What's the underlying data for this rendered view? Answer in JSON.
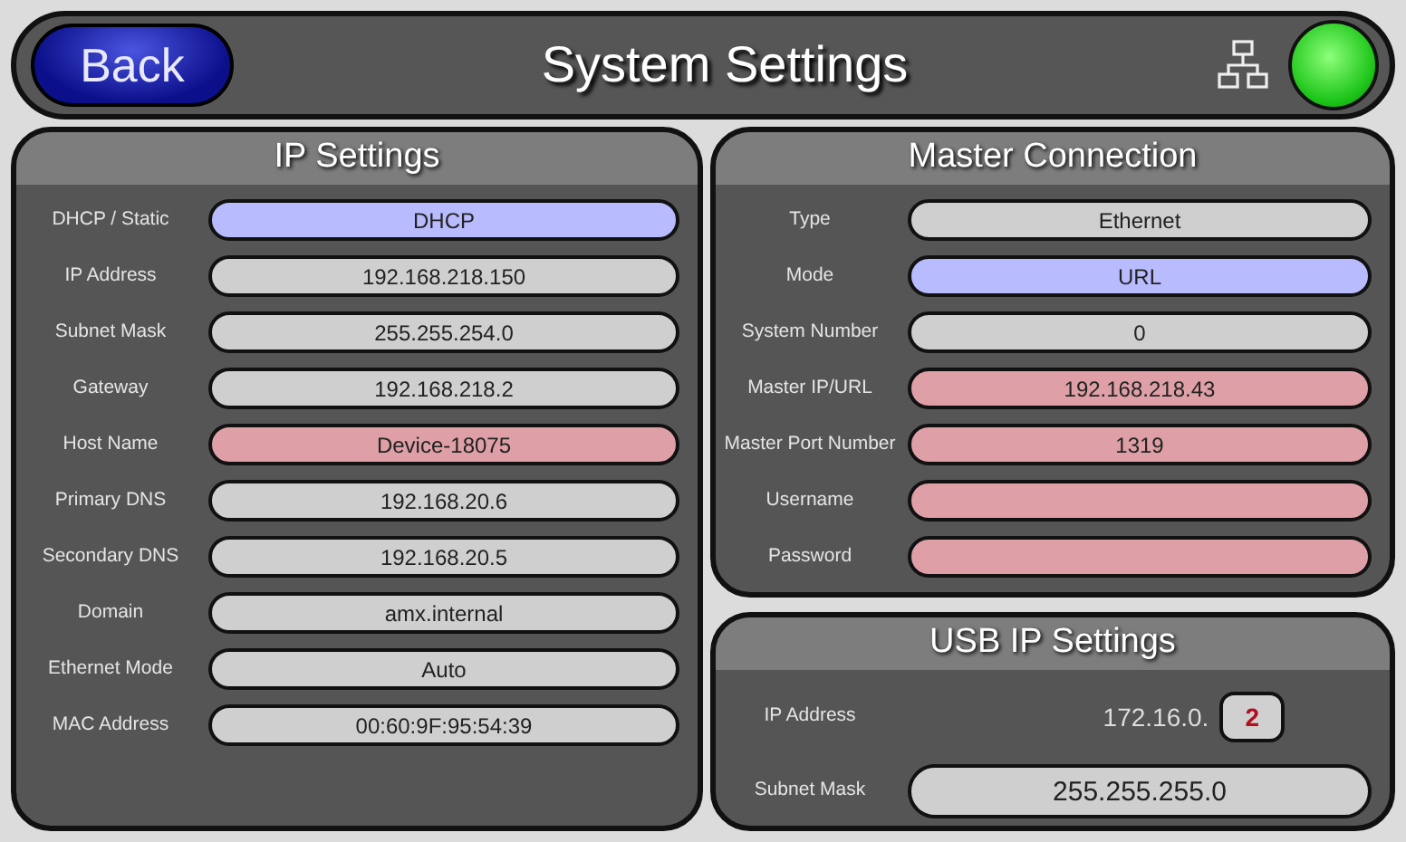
{
  "header": {
    "back_button": "Back",
    "title": "System Settings",
    "status_led": {
      "on": true
    }
  },
  "ip_settings": {
    "title": "IP Settings",
    "rows": [
      {
        "label": "DHCP / Static",
        "value": "DHCP",
        "kind": "toggle"
      },
      {
        "label": "IP Address",
        "value": "192.168.218.150",
        "kind": "display"
      },
      {
        "label": "Subnet Mask",
        "value": "255.255.254.0",
        "kind": "display"
      },
      {
        "label": "Gateway",
        "value": "192.168.218.2",
        "kind": "display"
      },
      {
        "label": "Host Name",
        "value": "Device-18075",
        "kind": "editable"
      },
      {
        "label": "Primary DNS",
        "value": "192.168.20.6",
        "kind": "display"
      },
      {
        "label": "Secondary DNS",
        "value": "192.168.20.5",
        "kind": "display"
      },
      {
        "label": "Domain",
        "value": "amx.internal",
        "kind": "display"
      },
      {
        "label": "Ethernet Mode",
        "value": "Auto",
        "kind": "display"
      },
      {
        "label": "MAC Address",
        "value": "00:60:9F:95:54:39",
        "kind": "display"
      }
    ]
  },
  "master_connection": {
    "title": "Master Connection",
    "rows": [
      {
        "label": "Type",
        "value": "Ethernet",
        "kind": "display"
      },
      {
        "label": "Mode",
        "value": "URL",
        "kind": "toggle"
      },
      {
        "label": "System Number",
        "value": "0",
        "kind": "display"
      },
      {
        "label": "Master IP/URL",
        "value": "192.168.218.43",
        "kind": "editable"
      },
      {
        "label": "Master Port Number",
        "value": "1319",
        "kind": "editable"
      },
      {
        "label": "Username",
        "kind": "editable"
      },
      {
        "label": "Password",
        "kind": "editable"
      }
    ]
  },
  "usb_ip_settings": {
    "title": "USB IP Settings",
    "ip_address": {
      "label": "IP Address",
      "prefix": "172.16.0.",
      "last_octet": "2"
    },
    "subnet_mask": {
      "label": "Subnet Mask",
      "value": "255.255.255.0"
    }
  }
}
